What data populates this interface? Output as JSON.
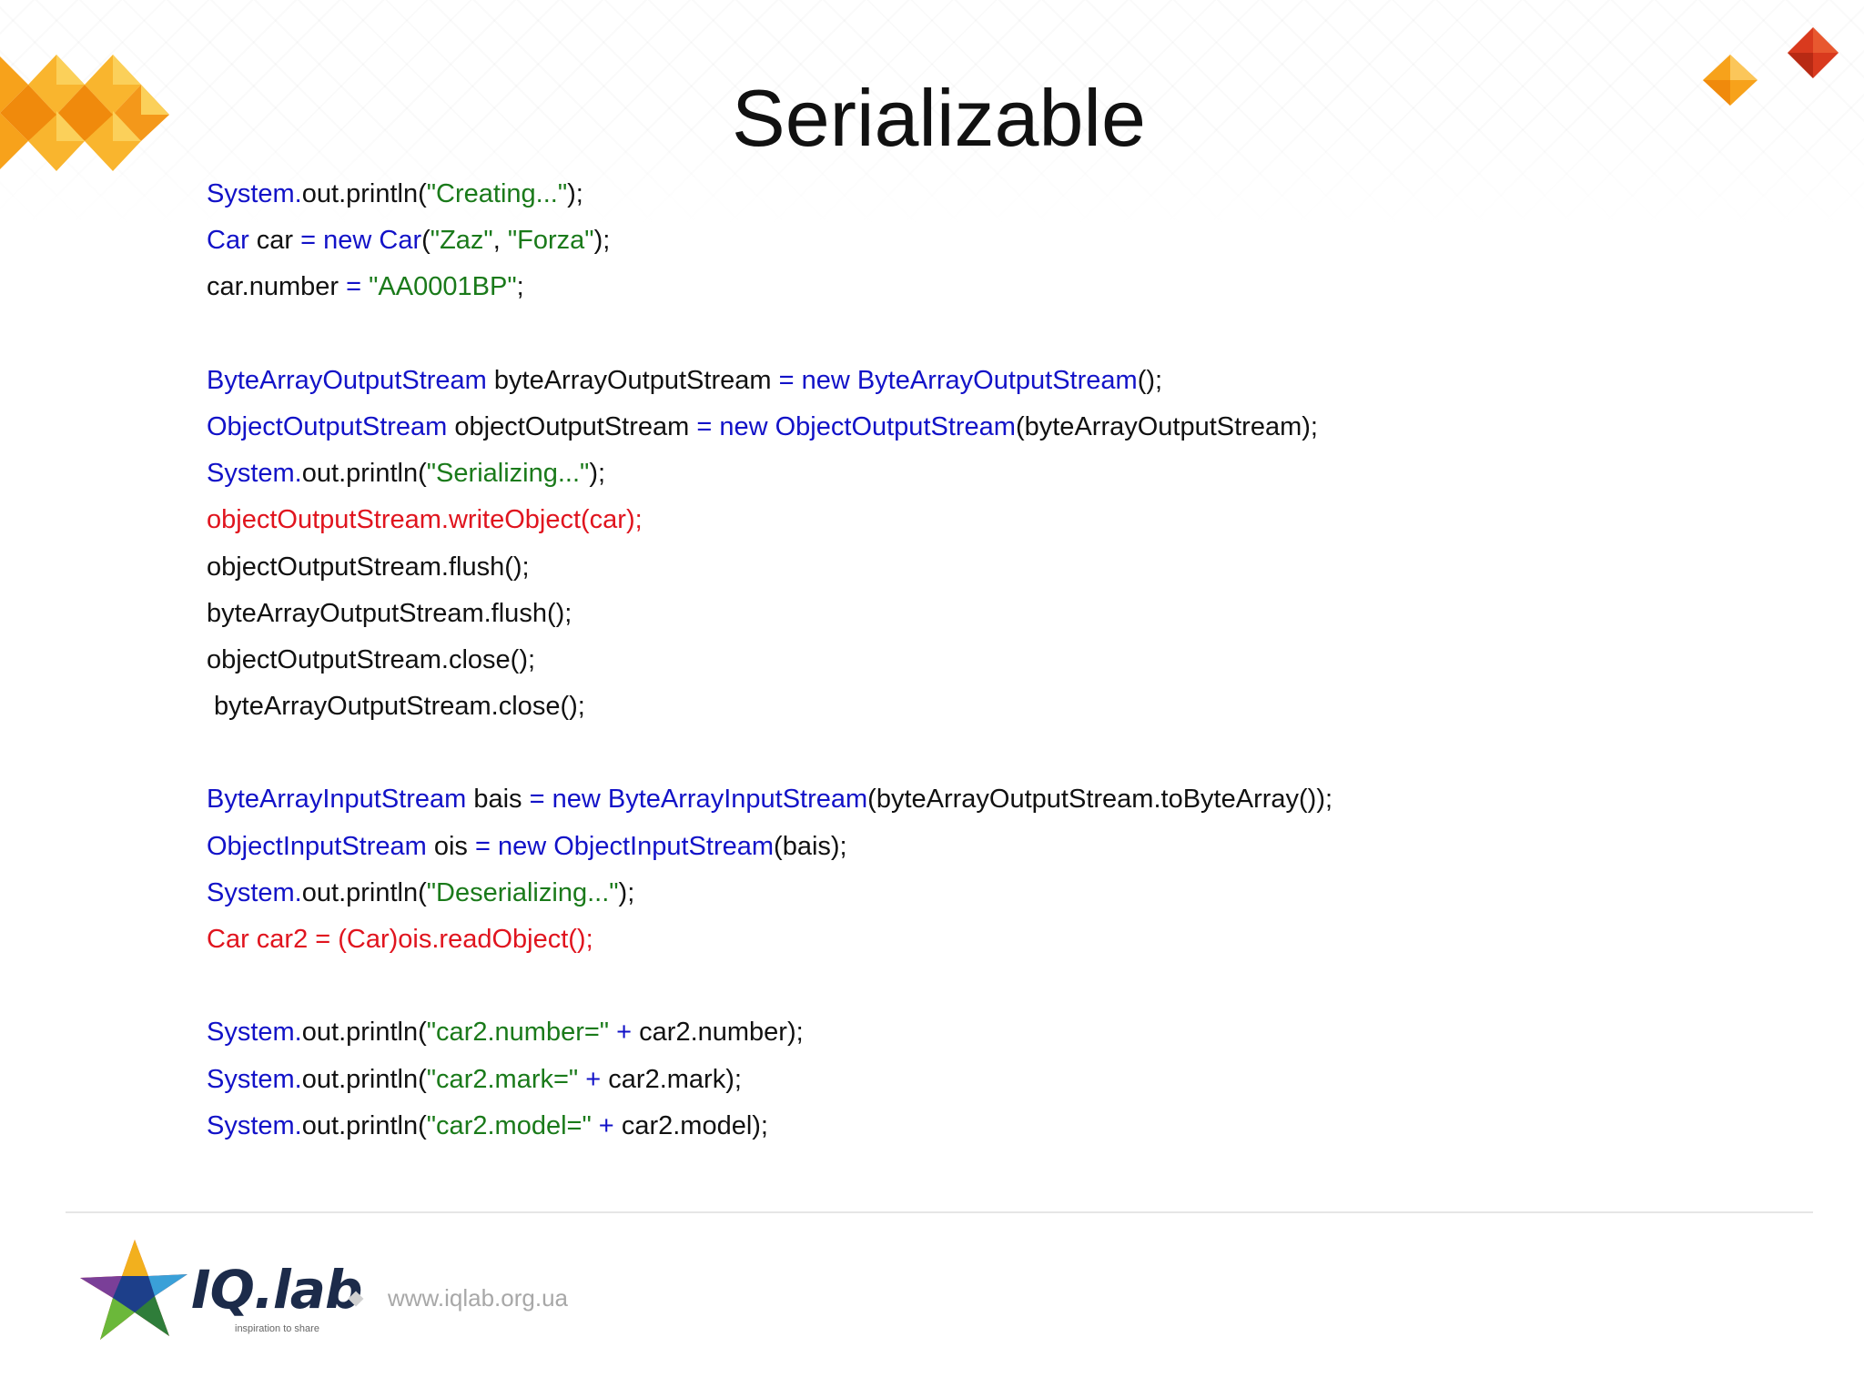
{
  "slide": {
    "title": "Serializable",
    "code_lines": [
      [
        {
          "t": "System.",
          "c": "type"
        },
        {
          "t": "out.println(",
          "c": "plain"
        },
        {
          "t": "\"Creating...\"",
          "c": "str"
        },
        {
          "t": ");",
          "c": "plain"
        }
      ],
      [
        {
          "t": "Car",
          "c": "type"
        },
        {
          "t": " car ",
          "c": "plain"
        },
        {
          "t": "= new Car",
          "c": "type"
        },
        {
          "t": "(",
          "c": "plain"
        },
        {
          "t": "\"Zaz\"",
          "c": "str"
        },
        {
          "t": ", ",
          "c": "plain"
        },
        {
          "t": "\"Forza\"",
          "c": "str"
        },
        {
          "t": ");",
          "c": "plain"
        }
      ],
      [
        {
          "t": "car.number ",
          "c": "plain"
        },
        {
          "t": "= ",
          "c": "type"
        },
        {
          "t": "\"AA0001BP\"",
          "c": "str"
        },
        {
          "t": ";",
          "c": "plain"
        }
      ],
      [],
      [
        {
          "t": "ByteArrayOutputStream",
          "c": "type"
        },
        {
          "t": " byteArrayOutputStream ",
          "c": "plain"
        },
        {
          "t": "= new ByteArrayOutputStream",
          "c": "type"
        },
        {
          "t": "();",
          "c": "plain"
        }
      ],
      [
        {
          "t": "ObjectOutputStream",
          "c": "type"
        },
        {
          "t": " objectOutputStream ",
          "c": "plain"
        },
        {
          "t": "= new ObjectOutputStream",
          "c": "type"
        },
        {
          "t": "(byteArrayOutputStream);",
          "c": "plain"
        }
      ],
      [
        {
          "t": "System.",
          "c": "type"
        },
        {
          "t": "out.println(",
          "c": "plain"
        },
        {
          "t": "\"Serializing...\"",
          "c": "str"
        },
        {
          "t": ");",
          "c": "plain"
        }
      ],
      [
        {
          "t": "objectOutputStream.writeObject(car);",
          "c": "red"
        }
      ],
      [
        {
          "t": "objectOutputStream.flush();",
          "c": "plain"
        }
      ],
      [
        {
          "t": "byteArrayOutputStream.flush();",
          "c": "plain"
        }
      ],
      [
        {
          "t": "objectOutputStream.close();",
          "c": "plain"
        }
      ],
      [
        {
          "t": " byteArrayOutputStream.close();",
          "c": "plain"
        }
      ],
      [],
      [
        {
          "t": "ByteArrayInputStream",
          "c": "type"
        },
        {
          "t": " bais ",
          "c": "plain"
        },
        {
          "t": "= new ByteArrayInputStream",
          "c": "type"
        },
        {
          "t": "(byteArrayOutputStream.toByteArray());",
          "c": "plain"
        }
      ],
      [
        {
          "t": "ObjectInputStream",
          "c": "type"
        },
        {
          "t": " ois ",
          "c": "plain"
        },
        {
          "t": "= new ObjectInputStream",
          "c": "type"
        },
        {
          "t": "(bais);",
          "c": "plain"
        }
      ],
      [
        {
          "t": "System.",
          "c": "type"
        },
        {
          "t": "out.println(",
          "c": "plain"
        },
        {
          "t": "\"Deserializing...\"",
          "c": "str"
        },
        {
          "t": ");",
          "c": "plain"
        }
      ],
      [
        {
          "t": "Car car2 = (Car)ois.readObject();",
          "c": "red"
        }
      ],
      [],
      [
        {
          "t": "System.",
          "c": "type"
        },
        {
          "t": "out.println(",
          "c": "plain"
        },
        {
          "t": "\"car2.number=\"",
          "c": "str"
        },
        {
          "t": " + ",
          "c": "type"
        },
        {
          "t": "car2.number);",
          "c": "plain"
        }
      ],
      [
        {
          "t": "System.",
          "c": "type"
        },
        {
          "t": "out.println(",
          "c": "plain"
        },
        {
          "t": "\"car2.mark=\"",
          "c": "str"
        },
        {
          "t": " + ",
          "c": "type"
        },
        {
          "t": "car2.mark);",
          "c": "plain"
        }
      ],
      [
        {
          "t": "System.",
          "c": "type"
        },
        {
          "t": "out.println(",
          "c": "plain"
        },
        {
          "t": "\"car2.model=\"",
          "c": "str"
        },
        {
          "t": " + ",
          "c": "type"
        },
        {
          "t": "car2.model);",
          "c": "plain"
        }
      ]
    ]
  },
  "footer": {
    "brand": "IQ.lab",
    "tagline": "inspiration to share",
    "url": "www.iqlab.org.ua",
    "logo_icon": "iqlab-star-logo-icon",
    "separator_icon": "diamond-icon"
  },
  "decorations": {
    "left_icon": "orange-diamond-pattern-icon",
    "right_icon": "orange-red-diamonds-icon"
  },
  "colors": {
    "type_keyword": "#1212c8",
    "string_literal": "#1a7a1a",
    "plain_code": "#111111",
    "highlight_red": "#e0141e",
    "accent_orange": "#f7a21b"
  }
}
